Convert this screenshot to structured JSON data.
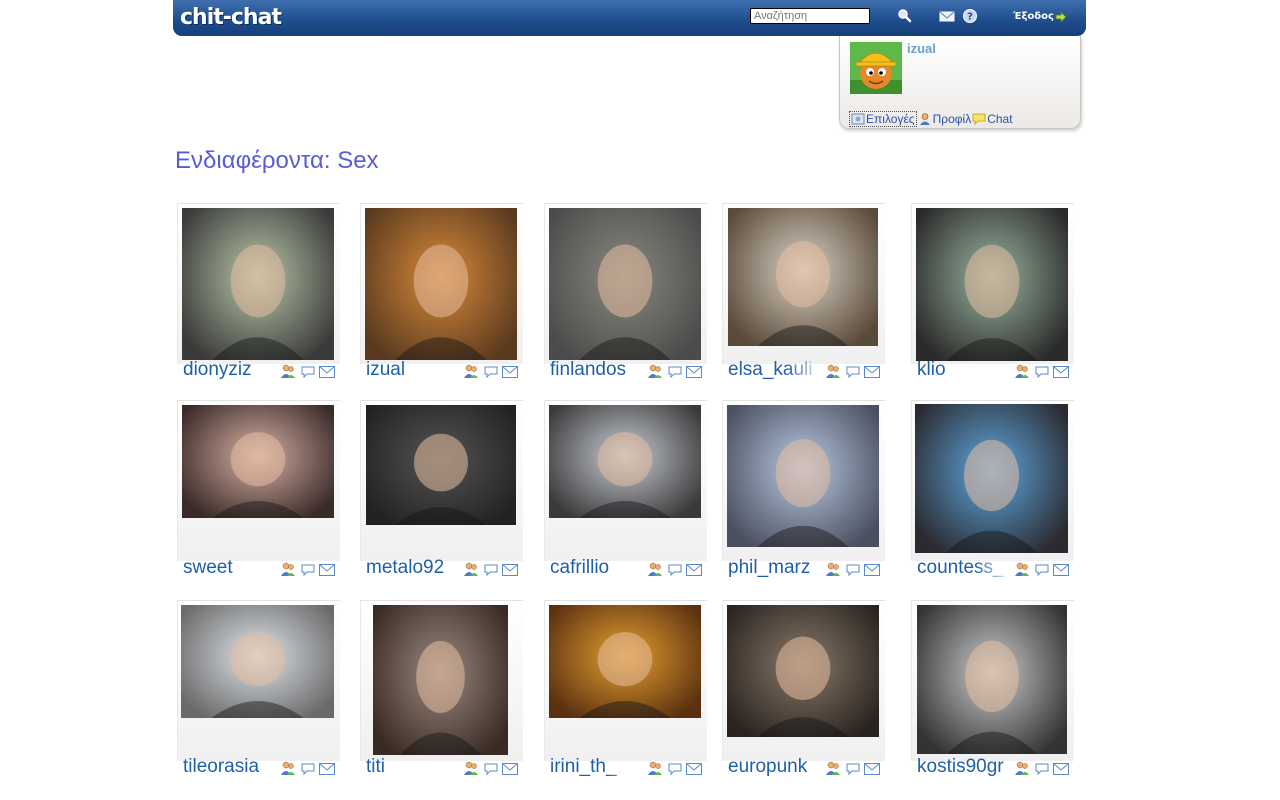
{
  "header": {
    "logo": "chit-chat",
    "search_placeholder": "Αναζήτηση",
    "exit_label": "Έξοδος"
  },
  "userbox": {
    "username": "izual",
    "links": [
      "Επιλογές",
      "Προφίλ",
      "Chat"
    ]
  },
  "page_title": "Ενδιαφέροντα: Sex",
  "users": [
    {
      "name": "dionyziz"
    },
    {
      "name": "izual"
    },
    {
      "name": "finlandos"
    },
    {
      "name": "elsa_kauli"
    },
    {
      "name": "klio"
    },
    {
      "name": "sweet"
    },
    {
      "name": "metalo92"
    },
    {
      "name": "cafrillio"
    },
    {
      "name": "phil_marz"
    },
    {
      "name": "countess_"
    },
    {
      "name": "tileorasia"
    },
    {
      "name": "titi"
    },
    {
      "name": "irini_th_"
    },
    {
      "name": "europunk"
    },
    {
      "name": "kostis90gr"
    }
  ],
  "colors": {
    "header_blue": "#1f4f8f",
    "title": "#5b5bd6",
    "username_link": "#1f5fa8"
  }
}
